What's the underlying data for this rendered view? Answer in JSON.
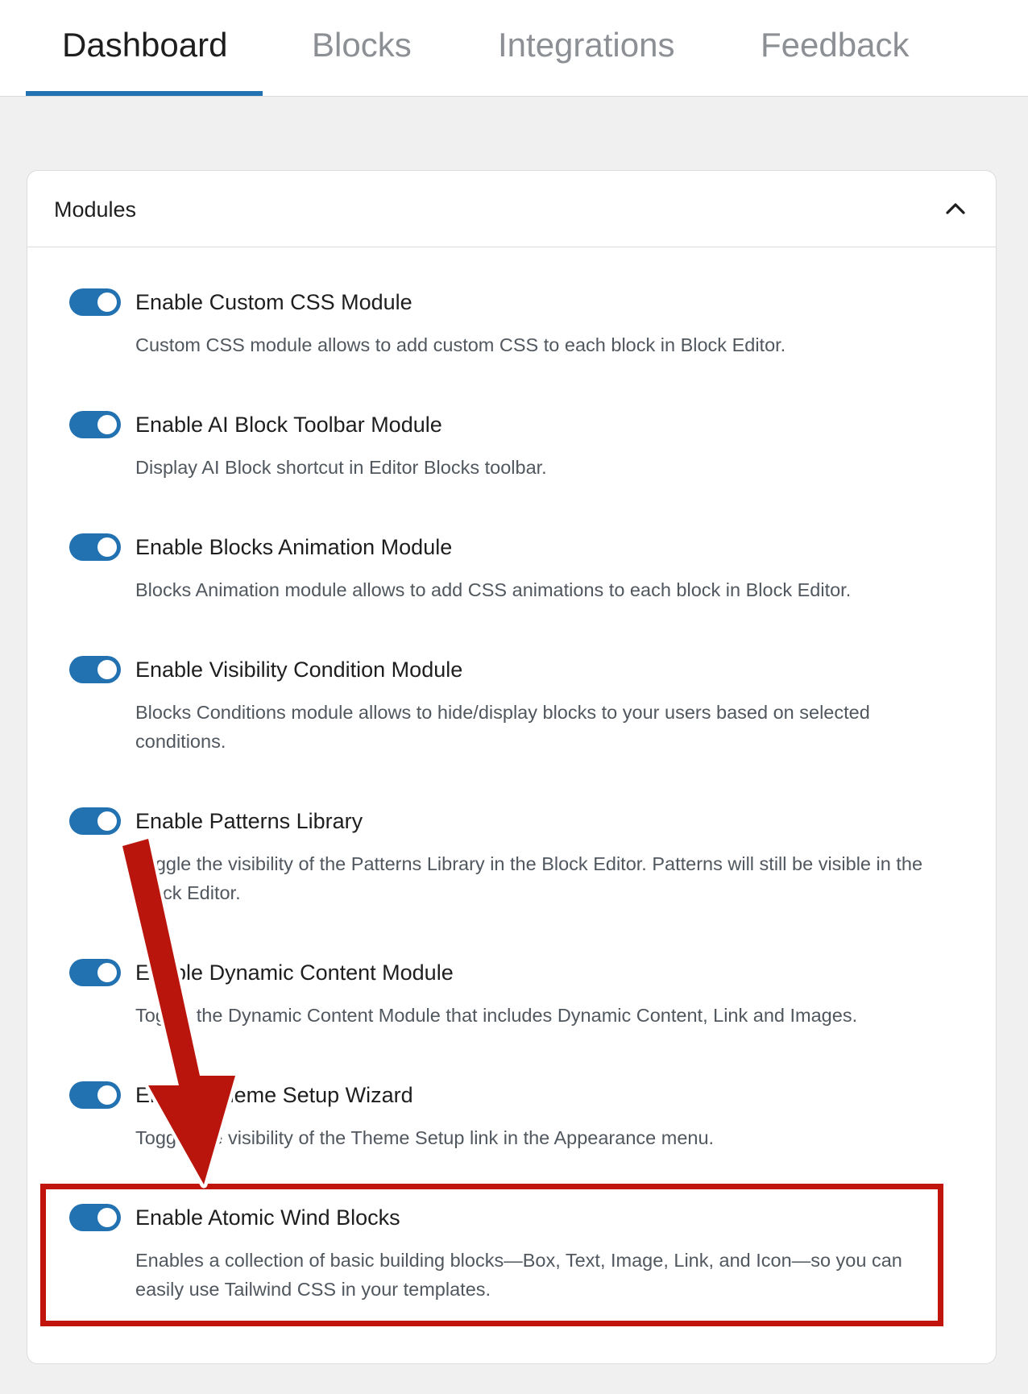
{
  "tabs": [
    {
      "label": "Dashboard",
      "active": true
    },
    {
      "label": "Blocks",
      "active": false
    },
    {
      "label": "Integrations",
      "active": false
    },
    {
      "label": "Feedback",
      "active": false
    }
  ],
  "panel": {
    "title": "Modules",
    "collapse_icon": "chevron-up-icon"
  },
  "modules": [
    {
      "title": "Enable Custom CSS Module",
      "description": "Custom CSS module allows to add custom CSS to each block in Block Editor.",
      "enabled": true
    },
    {
      "title": "Enable AI Block Toolbar Module",
      "description": "Display AI Block shortcut in Editor Blocks toolbar.",
      "enabled": true
    },
    {
      "title": "Enable Blocks Animation Module",
      "description": "Blocks Animation module allows to add CSS animations to each block in Block Editor.",
      "enabled": true
    },
    {
      "title": "Enable Visibility Condition Module",
      "description": "Blocks Conditions module allows to hide/display blocks to your users based on selected conditions.",
      "enabled": true
    },
    {
      "title": "Enable Patterns Library",
      "description": "Toggle the visibility of the Patterns Library in the Block Editor. Patterns will still be visible in the Block Editor.",
      "enabled": true
    },
    {
      "title": "Enable Dynamic Content Module",
      "description": "Toggle the Dynamic Content Module that includes Dynamic Content, Link and Images.",
      "enabled": true
    },
    {
      "title": "Enable Theme Setup Wizard",
      "description": "Toggle the visibility of the Theme Setup link in the Appearance menu.",
      "enabled": true
    },
    {
      "title": "Enable Atomic Wind Blocks",
      "description": "Enables a collection of basic building blocks—Box, Text, Image, Link, and Icon—so you can easily use Tailwind CSS in your templates.",
      "enabled": true
    }
  ],
  "colors": {
    "accent": "#2271b1",
    "annotation_red": "#c1150b"
  }
}
